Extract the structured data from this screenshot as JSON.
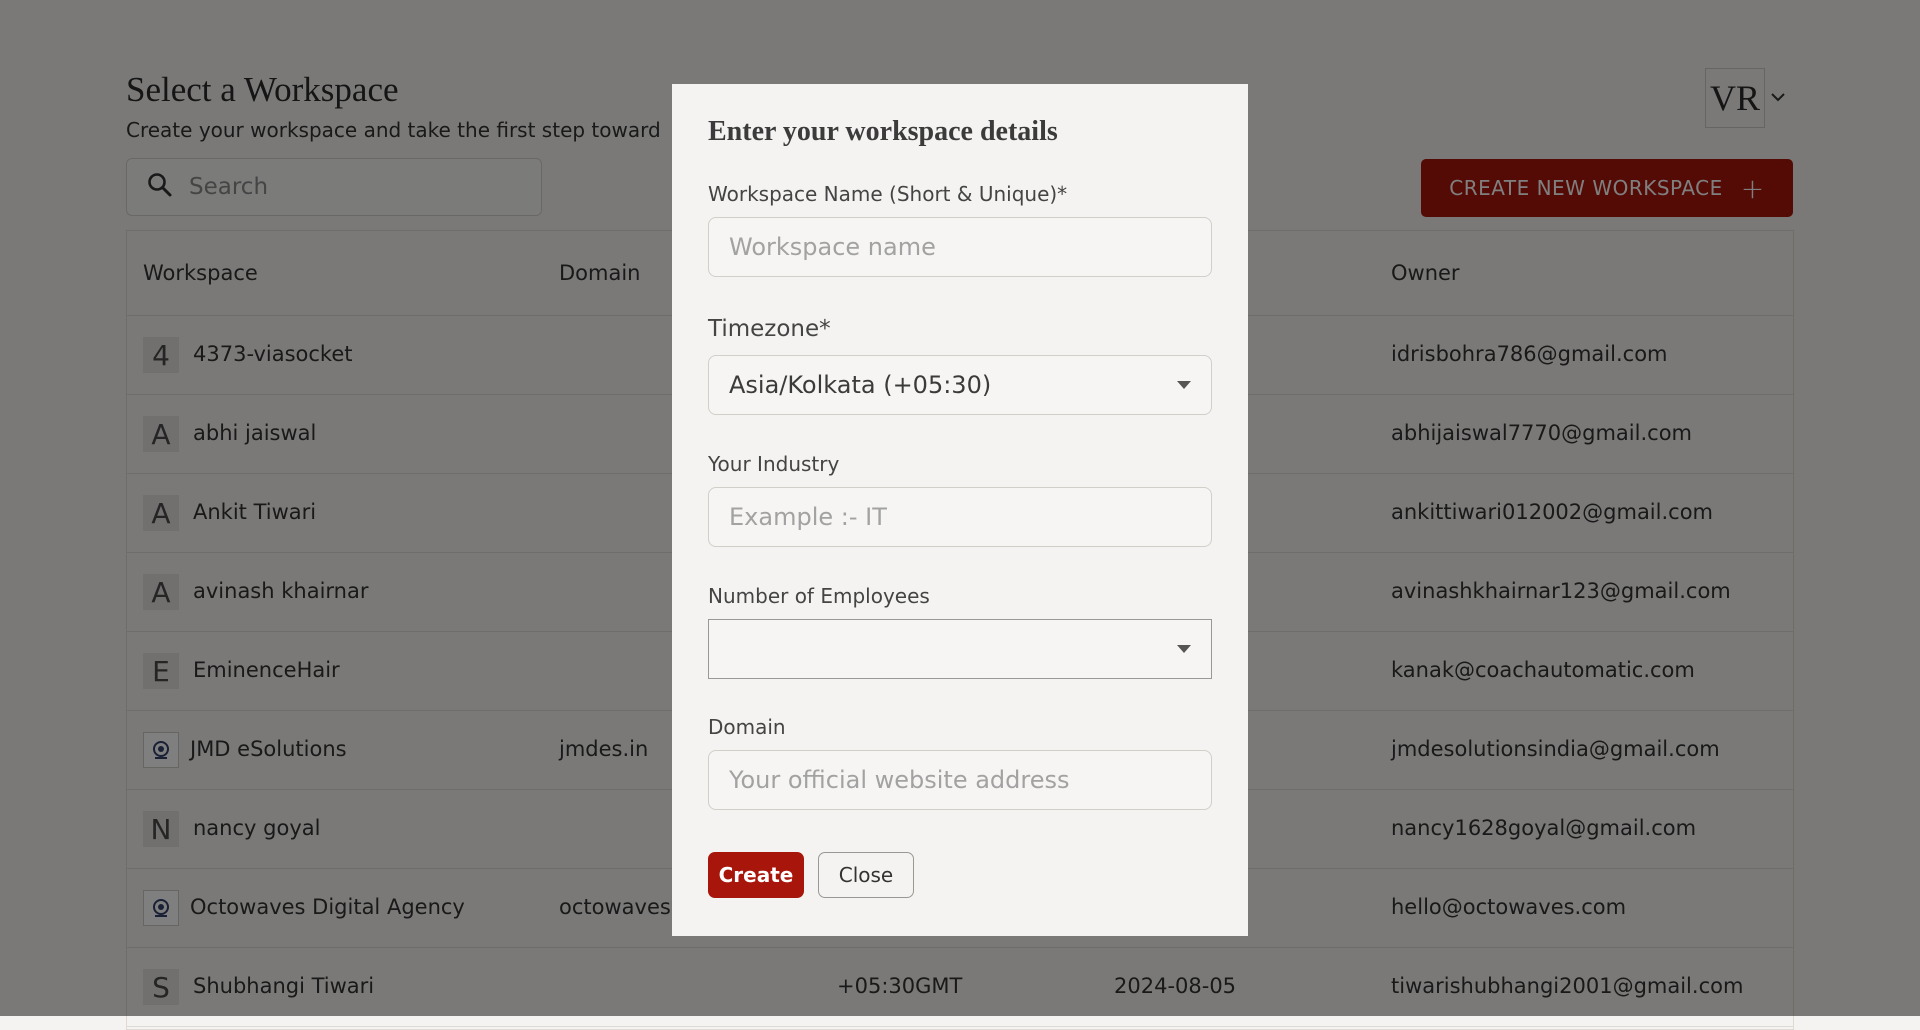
{
  "header": {
    "title": "Select a Workspace",
    "subtitle": "Create your workspace and take the first step toward",
    "avatar_initials": "VR"
  },
  "search": {
    "placeholder": "Search"
  },
  "create_button": {
    "label": "CREATE NEW WORKSPACE",
    "icon": "plus-icon"
  },
  "table": {
    "columns": [
      "Workspace",
      "Domain",
      "Owner"
    ],
    "rows": [
      {
        "initial": "4",
        "name": "4373-viasocket",
        "domain": "",
        "timezone": "",
        "date": "",
        "owner": "idrisbohra786@gmail.com"
      },
      {
        "initial": "A",
        "name": "abhi jaiswal",
        "domain": "",
        "timezone": "",
        "date": "",
        "owner": "abhijaiswal7770@gmail.com"
      },
      {
        "initial": "A",
        "name": "Ankit Tiwari",
        "domain": "",
        "timezone": "",
        "date": "",
        "owner": "ankittiwari012002@gmail.com"
      },
      {
        "initial": "A",
        "name": "avinash khairnar",
        "domain": "",
        "timezone": "",
        "date": "",
        "owner": "avinashkhairnar123@gmail.com"
      },
      {
        "initial": "E",
        "name": "EminenceHair",
        "domain": "",
        "timezone": "",
        "date": "",
        "owner": "kanak@coachautomatic.com"
      },
      {
        "initial": "",
        "name": "JMD eSolutions",
        "domain": "jmdes.in",
        "timezone": "",
        "date": "",
        "owner": "jmdesolutionsindia@gmail.com"
      },
      {
        "initial": "N",
        "name": "nancy goyal",
        "domain": "",
        "timezone": "",
        "date": "",
        "owner": "nancy1628goyal@gmail.com"
      },
      {
        "initial": "",
        "name": "Octowaves Digital Agency",
        "domain": "octowaves",
        "timezone": "",
        "date": "",
        "owner": "hello@octowaves.com"
      },
      {
        "initial": "S",
        "name": "Shubhangi Tiwari",
        "domain": "",
        "timezone": "+05:30GMT",
        "date": "2024-08-05",
        "owner": "tiwarishubhangi2001@gmail.com"
      }
    ]
  },
  "modal": {
    "title": "Enter your workspace details",
    "workspace_name_label": "Workspace Name (Short & Unique)*",
    "workspace_name_placeholder": "Workspace name",
    "timezone_label": "Timezone*",
    "timezone_value": "Asia/Kolkata (+05:30)",
    "industry_label": "Your Industry",
    "industry_placeholder": "Example :- IT",
    "employees_label": "Number of Employees",
    "employees_value": "",
    "domain_label": "Domain",
    "domain_placeholder": "Your official website address",
    "create_label": "Create",
    "close_label": "Close"
  },
  "colors": {
    "accent": "#a8150a",
    "overlay": "rgba(0,0,0,0.5)"
  }
}
